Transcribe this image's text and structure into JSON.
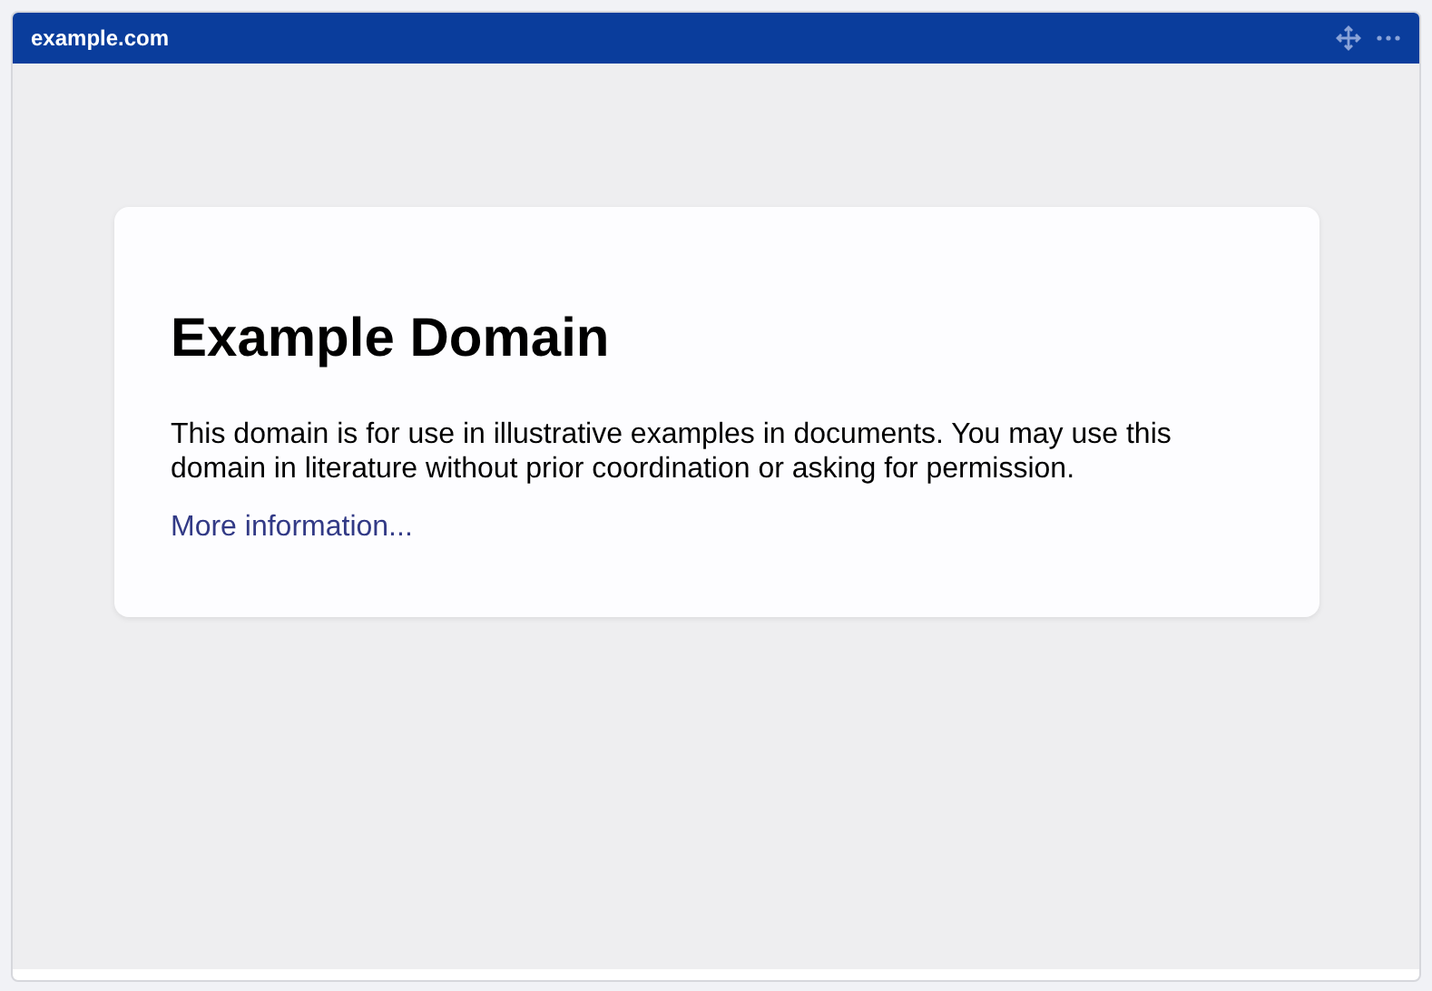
{
  "window": {
    "title": "example.com"
  },
  "page": {
    "heading": "Example Domain",
    "text": "This domain is for use in illustrative examples in documents. You may use this domain in literature without prior coordination or asking for permission.",
    "link": "More information..."
  }
}
